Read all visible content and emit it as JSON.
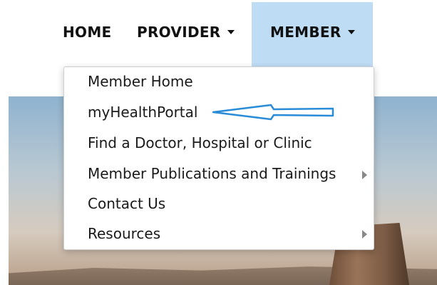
{
  "nav": {
    "home": "HOME",
    "provider": "PROVIDER",
    "member": "MEMBER"
  },
  "member_menu": {
    "items": [
      {
        "label": "Member Home"
      },
      {
        "label": "myHealthPortal"
      },
      {
        "label": "Find a Doctor, Hospital or Clinic"
      },
      {
        "label": "Member Publications and Trainings",
        "has_submenu": true
      },
      {
        "label": "Contact Us"
      },
      {
        "label": "Resources",
        "has_submenu": true
      }
    ]
  },
  "colors": {
    "active_tab": "#bfdcf5",
    "annotation_arrow": "#2a8bd6",
    "text": "#1a1a1a"
  },
  "icons": {
    "caret": "chevron-down-icon",
    "submenu": "chevron-right-icon",
    "annotation": "arrow-left-icon"
  }
}
